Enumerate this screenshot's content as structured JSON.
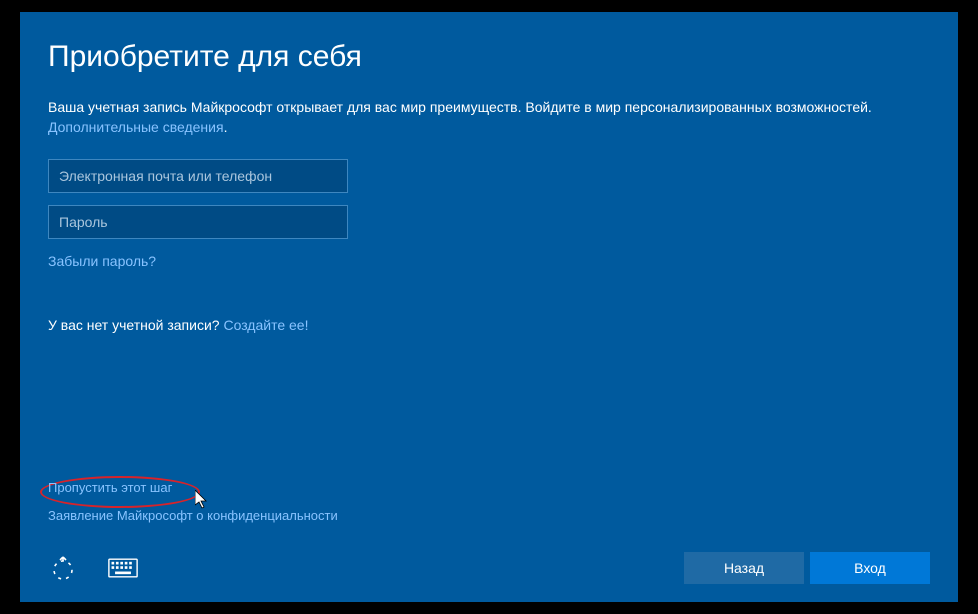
{
  "title": "Приобретите для себя",
  "body": {
    "text1": "Ваша учетная запись Майкрософт открывает для вас мир преимуществ. Войдите в мир персонализированных возможностей. ",
    "learn_more": "Дополнительные сведения",
    "period": "."
  },
  "inputs": {
    "email_placeholder": "Электронная почта или телефон",
    "password_placeholder": "Пароль"
  },
  "forgot_password": "Забыли пароль?",
  "no_account": {
    "text": "У вас нет учетной записи? ",
    "create": "Создайте ее!"
  },
  "skip": "Пропустить этот шаг",
  "privacy": "Заявление Майкрософт о конфиденциальности",
  "buttons": {
    "back": "Назад",
    "signin": "Вход"
  }
}
